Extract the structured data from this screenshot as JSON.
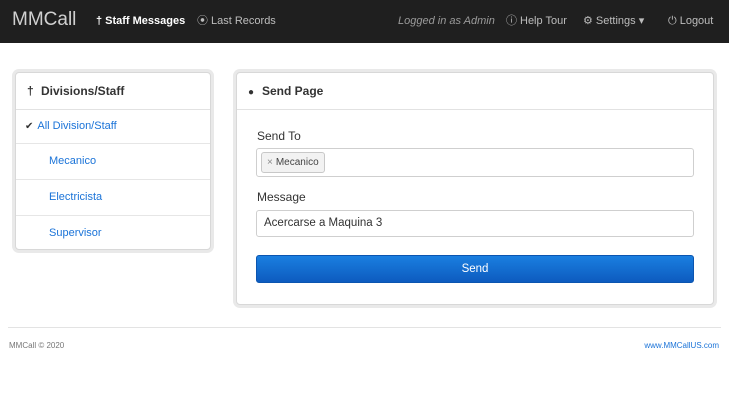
{
  "navbar": {
    "brand": "MMCall",
    "items": [
      {
        "icon": "person-icon",
        "glyph": "†",
        "label": "Staff Messages"
      },
      {
        "icon": "clock-icon",
        "glyph": "⦿",
        "label": "Last Records"
      }
    ],
    "logged_in": "Logged in as Admin",
    "help": {
      "icon": "info-icon",
      "glyph": "ⓘ",
      "label": "Help Tour"
    },
    "settings": {
      "icon": "cogs-icon",
      "glyph": "⚙",
      "label": "Settings",
      "caret": "▾"
    },
    "logout": {
      "icon": "power-icon",
      "glyph": "⏻",
      "label": "Logout"
    }
  },
  "divisions": {
    "title": "Divisions/Staff",
    "title_icon_glyph": "†",
    "root": {
      "chevron": "✔",
      "label": "All Division/Staff"
    },
    "items": [
      "Mecanico",
      "Electricista",
      "Supervisor"
    ]
  },
  "send_page": {
    "title": "Send Page",
    "title_icon_glyph": "●",
    "send_to_label": "Send To",
    "recipients": [
      {
        "remove": "×",
        "label": "Mecanico"
      }
    ],
    "message_label": "Message",
    "message_value": "Acercarse a Maquina 3",
    "send_label": "Send"
  },
  "footer": {
    "copyright": "MMCall © 2020",
    "link": "www.MMCallUS.com"
  },
  "colors": {
    "navbar_bg": "#1f1f1f",
    "link": "#1a73d8",
    "button": "#1470d8"
  }
}
